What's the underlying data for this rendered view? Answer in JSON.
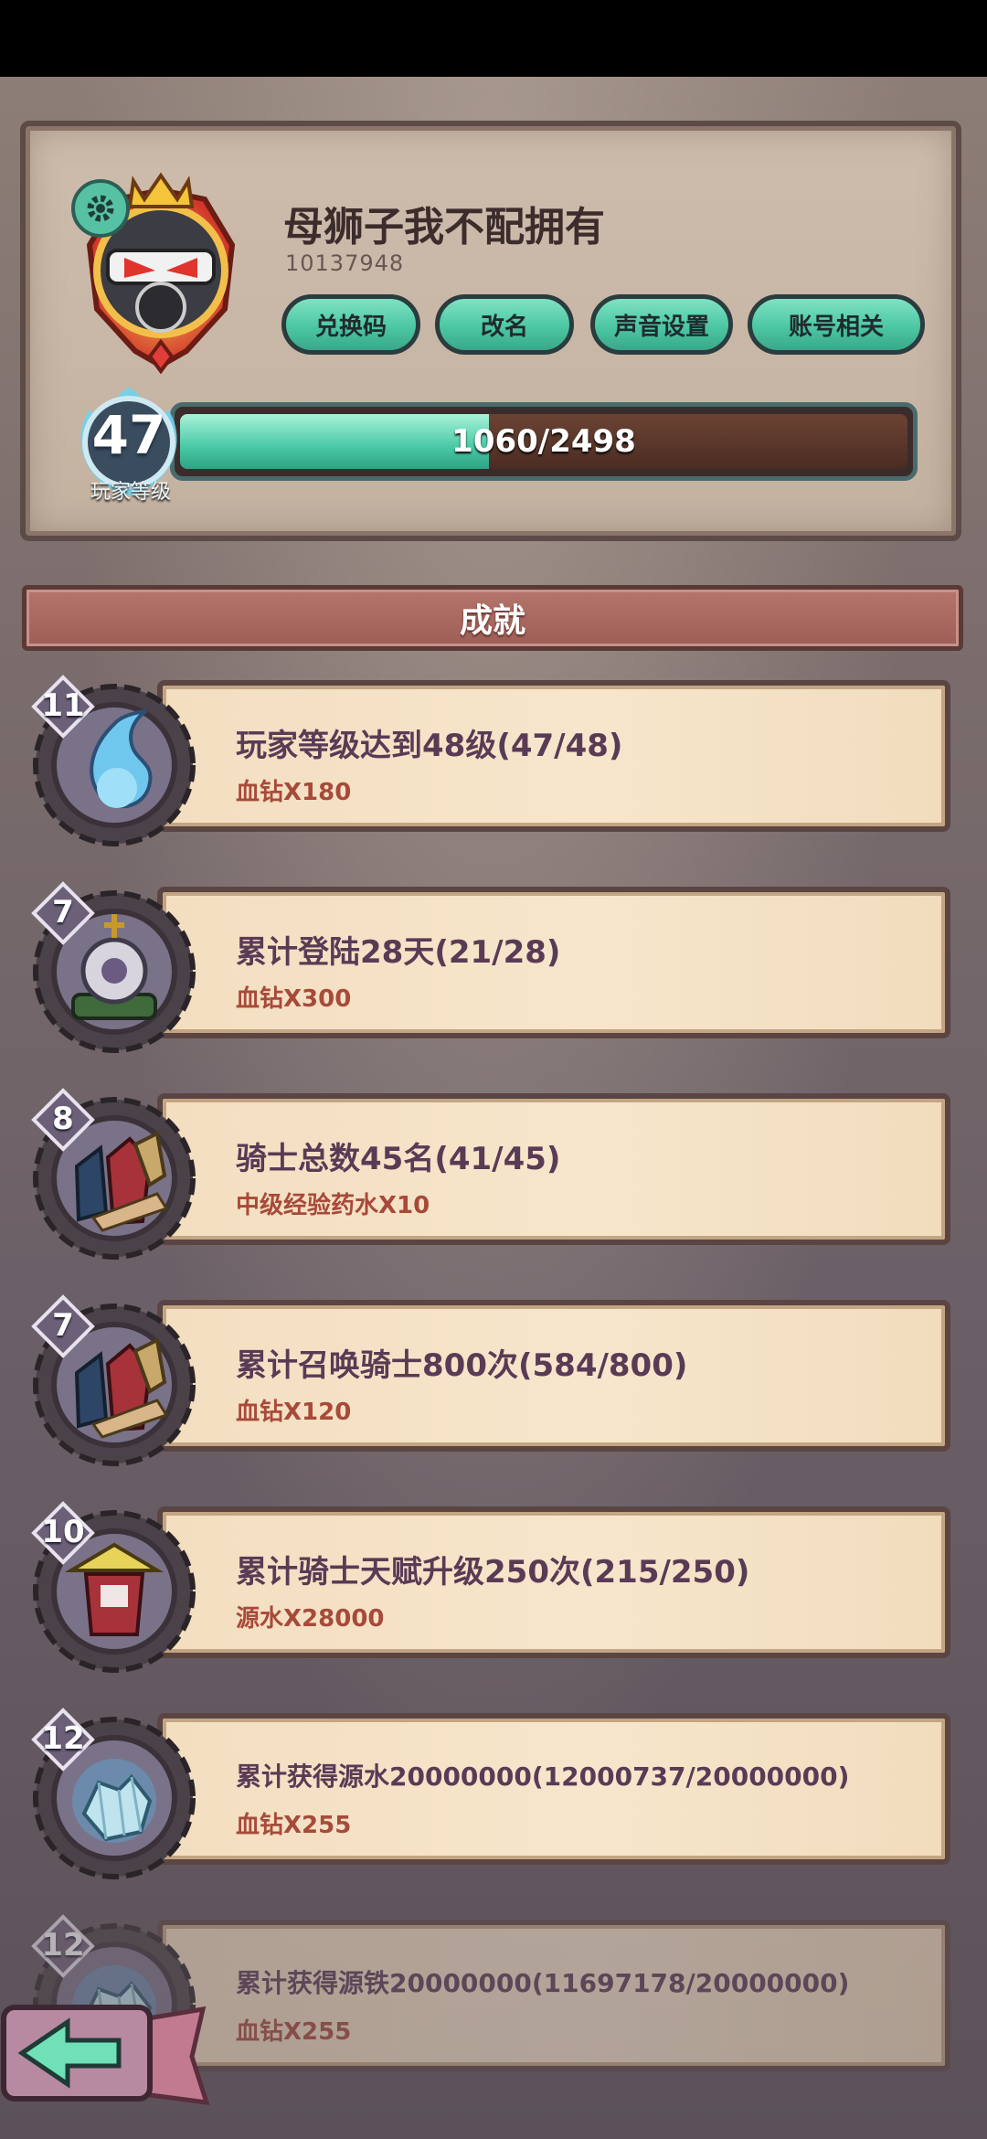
{
  "profile": {
    "username": "母狮子我不配拥有",
    "user_id": "10137948",
    "buttons": [
      "兑换码",
      "改名",
      "声音设置",
      "账号相关"
    ],
    "level": "47",
    "level_caption": "玩家等级",
    "exp_text": "1060/2498",
    "exp_progress": 0.424
  },
  "section": {
    "title": "成就"
  },
  "achievements": [
    {
      "level": "11",
      "title": "玩家等级达到48级(47/48)",
      "reward": "血钻X180",
      "icon": "blue-flame-icon"
    },
    {
      "level": "7",
      "title": "累计登陆28天(21/28)",
      "reward": "血钻X300",
      "icon": "gear-crown-icon"
    },
    {
      "level": "8",
      "title": "骑士总数45名(41/45)",
      "reward": "中级经验药水X10",
      "icon": "knights-icon"
    },
    {
      "level": "7",
      "title": "累计召唤骑士800次(584/800)",
      "reward": "血钻X120",
      "icon": "knights-icon"
    },
    {
      "level": "10",
      "title": "累计骑士天赋升级250次(215/250)",
      "reward": "源水X28000",
      "icon": "knight-helmet-icon"
    },
    {
      "level": "12",
      "title": "累计获得源水20000000(12000737/20000000)",
      "reward": "血钻X255",
      "icon": "crystal-ore-icon"
    },
    {
      "level": "12",
      "title": "累计获得源铁20000000(11697178/20000000)",
      "reward": "血钻X255",
      "icon": "crystal-ore-icon"
    }
  ],
  "colors": {
    "accent_green": "#4cc7a3",
    "reward_red": "#a74a3a",
    "title_purple": "#5a3b55"
  }
}
